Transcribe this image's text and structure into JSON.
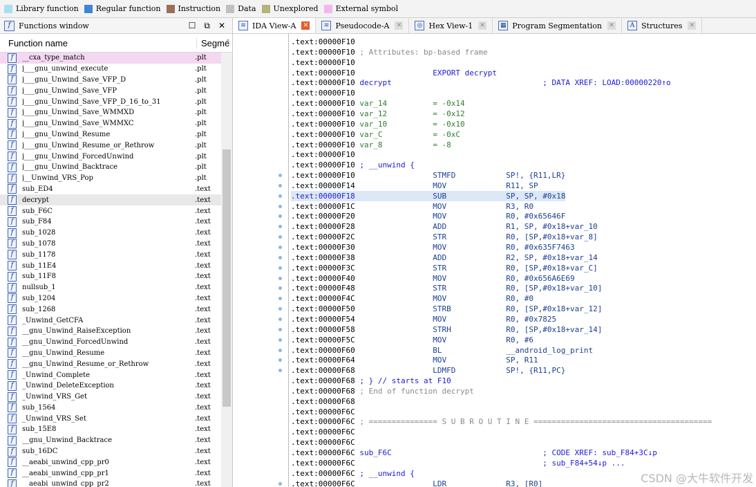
{
  "legend": [
    {
      "label": "Library function",
      "color": "#a8e0f0"
    },
    {
      "label": "Regular function",
      "color": "#3f84d6"
    },
    {
      "label": "Instruction",
      "color": "#9b6f55"
    },
    {
      "label": "Data",
      "color": "#c0c0c0"
    },
    {
      "label": "Unexplored",
      "color": "#b5b37a"
    },
    {
      "label": "External symbol",
      "color": "#f5b5ef"
    }
  ],
  "functions_window": {
    "title": "Functions window",
    "col_name": "Function name",
    "col_segment": "Segme",
    "rows": [
      {
        "name": "__cxa_type_match",
        "seg": ".plt"
      },
      {
        "name": "j___gnu_unwind_execute",
        "seg": ".plt"
      },
      {
        "name": "j___gnu_Unwind_Save_VFP_D",
        "seg": ".plt"
      },
      {
        "name": "j___gnu_Unwind_Save_VFP",
        "seg": ".plt"
      },
      {
        "name": "j___gnu_Unwind_Save_VFP_D_16_to_31",
        "seg": ".plt"
      },
      {
        "name": "j___gnu_Unwind_Save_WMMXD",
        "seg": ".plt"
      },
      {
        "name": "j___gnu_Unwind_Save_WMMXC",
        "seg": ".plt"
      },
      {
        "name": "j___gnu_Unwind_Resume",
        "seg": ".plt"
      },
      {
        "name": "j___gnu_Unwind_Resume_or_Rethrow",
        "seg": ".plt"
      },
      {
        "name": "j___gnu_Unwind_ForcedUnwind",
        "seg": ".plt"
      },
      {
        "name": "j___gnu_Unwind_Backtrace",
        "seg": ".plt"
      },
      {
        "name": "j__Unwind_VRS_Pop",
        "seg": ".plt"
      },
      {
        "name": "sub_ED4",
        "seg": ".text"
      },
      {
        "name": "decrypt",
        "seg": ".text"
      },
      {
        "name": "sub_F6C",
        "seg": ".text"
      },
      {
        "name": "sub_F84",
        "seg": ".text"
      },
      {
        "name": "sub_1028",
        "seg": ".text"
      },
      {
        "name": "sub_1078",
        "seg": ".text"
      },
      {
        "name": "sub_1178",
        "seg": ".text"
      },
      {
        "name": "sub_11E4",
        "seg": ".text"
      },
      {
        "name": "sub_11F8",
        "seg": ".text"
      },
      {
        "name": "nullsub_1",
        "seg": ".text"
      },
      {
        "name": "sub_1204",
        "seg": ".text"
      },
      {
        "name": "sub_1268",
        "seg": ".text"
      },
      {
        "name": "_Unwind_GetCFA",
        "seg": ".text"
      },
      {
        "name": "__gnu_Unwind_RaiseException",
        "seg": ".text"
      },
      {
        "name": "__gnu_Unwind_ForcedUnwind",
        "seg": ".text"
      },
      {
        "name": "__gnu_Unwind_Resume",
        "seg": ".text"
      },
      {
        "name": "__gnu_Unwind_Resume_or_Rethrow",
        "seg": ".text"
      },
      {
        "name": "_Unwind_Complete",
        "seg": ".text"
      },
      {
        "name": "_Unwind_DeleteException",
        "seg": ".text"
      },
      {
        "name": "_Unwind_VRS_Get",
        "seg": ".text"
      },
      {
        "name": "sub_1564",
        "seg": ".text"
      },
      {
        "name": "_Unwind_VRS_Set",
        "seg": ".text"
      },
      {
        "name": "sub_15E8",
        "seg": ".text"
      },
      {
        "name": "__gnu_Unwind_Backtrace",
        "seg": ".text"
      },
      {
        "name": "sub_16DC",
        "seg": ".text"
      },
      {
        "name": "__aeabi_unwind_cpp_pr0",
        "seg": ".text"
      },
      {
        "name": "__aeabi_unwind_cpp_pr1",
        "seg": ".text"
      },
      {
        "name": "__aeabi_unwind_cpp_pr2",
        "seg": ".text"
      }
    ]
  },
  "tabs": [
    {
      "label": "IDA View-A",
      "icon": "ida-view-icon"
    },
    {
      "label": "Pseudocode-A",
      "icon": "pseudocode-icon"
    },
    {
      "label": "Hex View-1",
      "icon": "hex-view-icon"
    },
    {
      "label": "Program Segmentation",
      "icon": "segmentation-icon"
    },
    {
      "label": "Structures",
      "icon": "structures-icon"
    }
  ],
  "code_lines": [
    [
      {
        "t": ".text:00000F10",
        "c": "addr"
      }
    ],
    [
      {
        "t": ".text:00000F10",
        "c": "addr"
      },
      {
        "t": " ; Attributes: bp-based frame",
        "c": "cmt"
      }
    ],
    [
      {
        "t": ".text:00000F10",
        "c": "addr"
      }
    ],
    [
      {
        "t": ".text:00000F10",
        "c": "addr"
      },
      {
        "t": "                 EXPORT decrypt",
        "c": "blue"
      }
    ],
    [
      {
        "t": ".text:00000F10",
        "c": "addr"
      },
      {
        "t": " decrypt",
        "c": "blue"
      },
      {
        "t": "                                 ; DATA XREF: LOAD:00000220↑o",
        "c": "blue"
      }
    ],
    [
      {
        "t": ".text:00000F10",
        "c": "addr"
      }
    ],
    [
      {
        "t": ".text:00000F10",
        "c": "addr"
      },
      {
        "t": " var_14",
        "c": "green"
      },
      {
        "t": "          = -0x14",
        "c": "green"
      }
    ],
    [
      {
        "t": ".text:00000F10",
        "c": "addr"
      },
      {
        "t": " var_12",
        "c": "green"
      },
      {
        "t": "          = -0x12",
        "c": "green"
      }
    ],
    [
      {
        "t": ".text:00000F10",
        "c": "addr"
      },
      {
        "t": " var_10",
        "c": "green"
      },
      {
        "t": "          = -0x10",
        "c": "green"
      }
    ],
    [
      {
        "t": ".text:00000F10",
        "c": "addr"
      },
      {
        "t": " var_C",
        "c": "green"
      },
      {
        "t": "           = -0xC",
        "c": "green"
      }
    ],
    [
      {
        "t": ".text:00000F10",
        "c": "addr"
      },
      {
        "t": " var_8",
        "c": "green"
      },
      {
        "t": "           = -8",
        "c": "green"
      }
    ],
    [
      {
        "t": ".text:00000F10",
        "c": "addr"
      }
    ],
    [
      {
        "t": ".text:00000F10",
        "c": "addr"
      },
      {
        "t": " ; __unwind {",
        "c": "blue"
      }
    ],
    [
      {
        "t": ".text:00000F10",
        "c": "addr"
      },
      {
        "t": "                 STMFD           SP!, {R11,LR}",
        "c": "navy"
      }
    ],
    [
      {
        "t": ".text:00000F14",
        "c": "addr"
      },
      {
        "t": "                 MOV             R11, SP",
        "c": "navy"
      }
    ],
    [
      {
        "t": ".text:00000F18",
        "c": "blue"
      },
      {
        "t": "                 SUB             SP, SP, #0x18",
        "c": "navy"
      }
    ],
    [
      {
        "t": ".text:00000F1C",
        "c": "addr"
      },
      {
        "t": "                 MOV             R3, R0",
        "c": "navy"
      }
    ],
    [
      {
        "t": ".text:00000F20",
        "c": "addr"
      },
      {
        "t": "                 MOV             R0, #0x65646F",
        "c": "navy"
      }
    ],
    [
      {
        "t": ".text:00000F28",
        "c": "addr"
      },
      {
        "t": "                 ADD             R1, SP, #0x18+var_10",
        "c": "navy"
      }
    ],
    [
      {
        "t": ".text:00000F2C",
        "c": "addr"
      },
      {
        "t": "                 STR             R0, [SP,#0x18+var_8]",
        "c": "navy"
      }
    ],
    [
      {
        "t": ".text:00000F30",
        "c": "addr"
      },
      {
        "t": "                 MOV             R0, #0x635F7463",
        "c": "navy"
      }
    ],
    [
      {
        "t": ".text:00000F38",
        "c": "addr"
      },
      {
        "t": "                 ADD             R2, SP, #0x18+var_14",
        "c": "navy"
      }
    ],
    [
      {
        "t": ".text:00000F3C",
        "c": "addr"
      },
      {
        "t": "                 STR             R0, [SP,#0x18+var_C]",
        "c": "navy"
      }
    ],
    [
      {
        "t": ".text:00000F40",
        "c": "addr"
      },
      {
        "t": "                 MOV             R0, #0x656A6E69",
        "c": "navy"
      }
    ],
    [
      {
        "t": ".text:00000F48",
        "c": "addr"
      },
      {
        "t": "                 STR             R0, [SP,#0x18+var_10]",
        "c": "navy"
      }
    ],
    [
      {
        "t": ".text:00000F4C",
        "c": "addr"
      },
      {
        "t": "                 MOV             R0, #0",
        "c": "navy"
      }
    ],
    [
      {
        "t": ".text:00000F50",
        "c": "addr"
      },
      {
        "t": "                 STRB            R0, [SP,#0x18+var_12]",
        "c": "navy"
      }
    ],
    [
      {
        "t": ".text:00000F54",
        "c": "addr"
      },
      {
        "t": "                 MOV             R0, #0x7825",
        "c": "navy"
      }
    ],
    [
      {
        "t": ".text:00000F58",
        "c": "addr"
      },
      {
        "t": "                 STRH            R0, [SP,#0x18+var_14]",
        "c": "navy"
      }
    ],
    [
      {
        "t": ".text:00000F5C",
        "c": "addr"
      },
      {
        "t": "                 MOV             R0, #6",
        "c": "navy"
      }
    ],
    [
      {
        "t": ".text:00000F60",
        "c": "addr"
      },
      {
        "t": "                 BL              __android_log_print",
        "c": "navy"
      }
    ],
    [
      {
        "t": ".text:00000F64",
        "c": "addr"
      },
      {
        "t": "                 MOV             SP, R11",
        "c": "navy"
      }
    ],
    [
      {
        "t": ".text:00000F68",
        "c": "addr"
      },
      {
        "t": "                 LDMFD           SP!, {R11,PC}",
        "c": "navy"
      }
    ],
    [
      {
        "t": ".text:00000F68",
        "c": "addr"
      },
      {
        "t": " ; } // starts at F10",
        "c": "blue"
      }
    ],
    [
      {
        "t": ".text:00000F68",
        "c": "addr"
      },
      {
        "t": " ; End of function decrypt",
        "c": "cmt"
      }
    ],
    [
      {
        "t": ".text:00000F68",
        "c": "addr"
      }
    ],
    [
      {
        "t": ".text:00000F6C",
        "c": "addr"
      }
    ],
    [
      {
        "t": ".text:00000F6C",
        "c": "addr"
      },
      {
        "t": " ; =============== S U B R O U T I N E =======================================",
        "c": "cmt"
      }
    ],
    [
      {
        "t": ".text:00000F6C",
        "c": "addr"
      }
    ],
    [
      {
        "t": ".text:00000F6C",
        "c": "addr"
      }
    ],
    [
      {
        "t": ".text:00000F6C",
        "c": "addr"
      },
      {
        "t": " sub_F6C",
        "c": "blue"
      },
      {
        "t": "                                 ; CODE XREF: sub_F84+3C↓p",
        "c": "blue"
      }
    ],
    [
      {
        "t": ".text:00000F6C",
        "c": "addr"
      },
      {
        "t": "                                         ; sub_F84+54↓p ...",
        "c": "blue"
      }
    ],
    [
      {
        "t": ".text:00000F6C",
        "c": "addr"
      },
      {
        "t": " ; __unwind {",
        "c": "blue"
      }
    ],
    [
      {
        "t": ".text:00000F6C",
        "c": "addr"
      },
      {
        "t": "                 LDR             R3, [R0]",
        "c": "navy"
      }
    ]
  ],
  "watermark": "CSDN @大牛软件开发"
}
